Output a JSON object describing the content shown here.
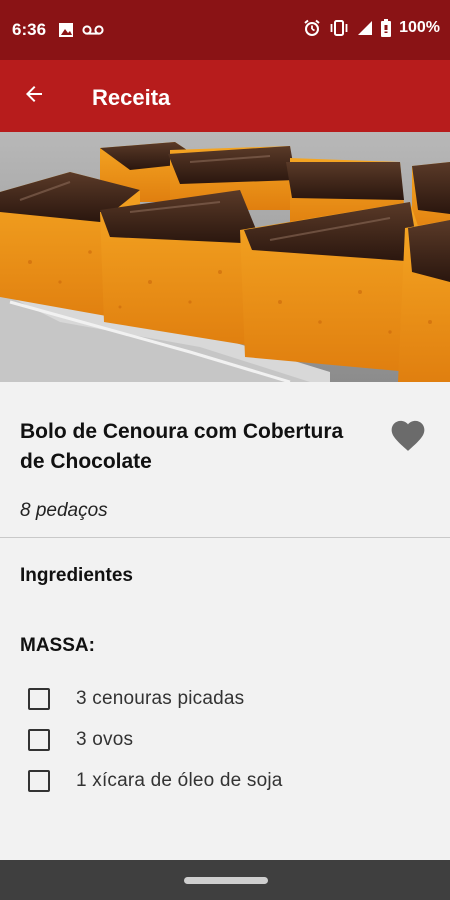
{
  "status_bar": {
    "time": "6:36",
    "battery": "100%",
    "icons": [
      "image-icon",
      "voicemail-icon",
      "alarm-icon",
      "vibrate-icon",
      "signal-icon",
      "battery-icon"
    ]
  },
  "app_bar": {
    "title": "Receita",
    "back_icon": "arrow-left-icon"
  },
  "colors": {
    "status_bar": "#8a1315",
    "app_bar": "#b71c1c",
    "background": "#f2f2f2",
    "nav_bar": "#3f3f3f"
  },
  "recipe": {
    "title": "Bolo de Cenoura com Cobertura de Chocolate",
    "yield": "8 pedaços",
    "favorite_icon": "heart-icon",
    "section_title": "Ingredientes",
    "groups": [
      {
        "title": "MASSA:",
        "items": [
          "3 cenouras picadas",
          "3 ovos",
          "1 xícara de óleo de soja"
        ]
      }
    ]
  }
}
